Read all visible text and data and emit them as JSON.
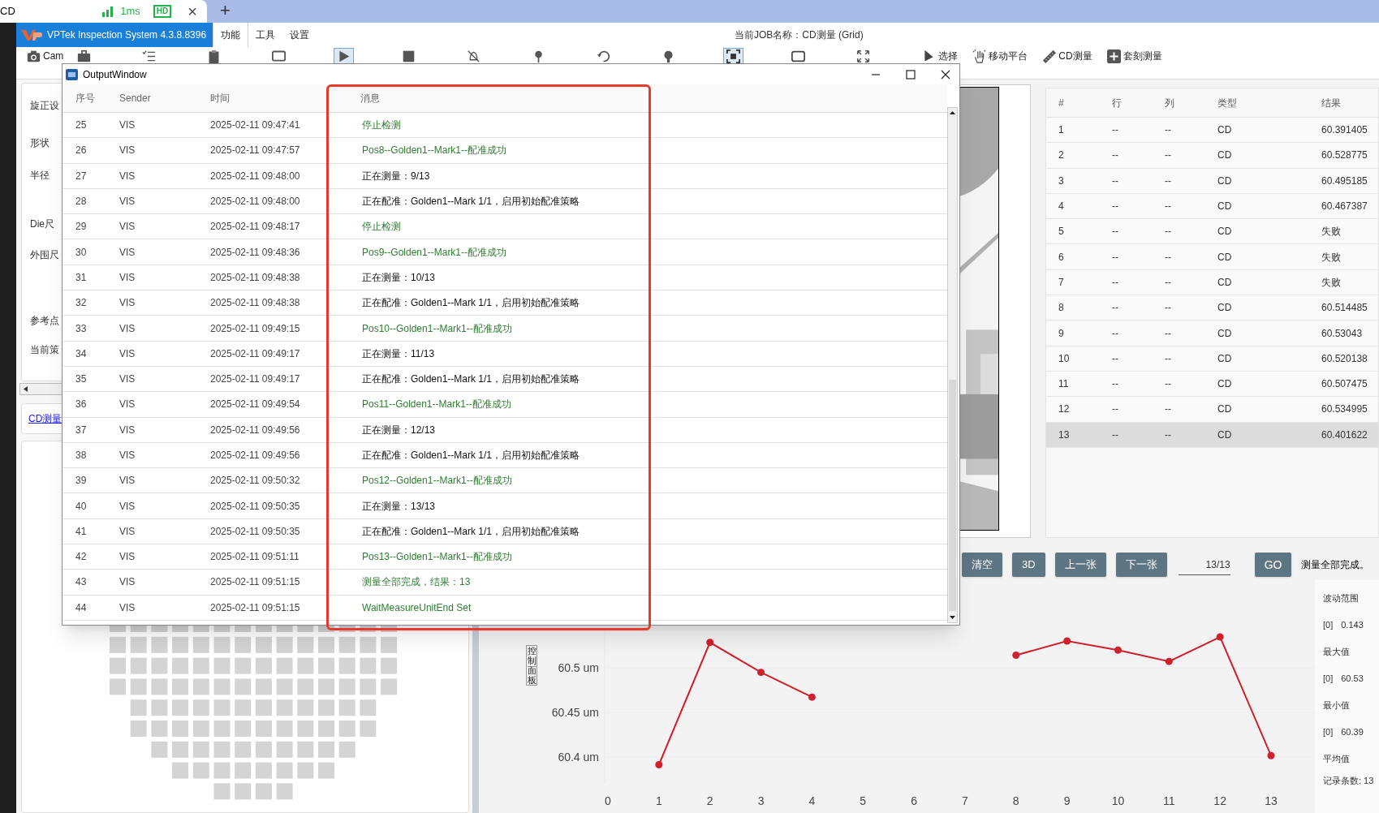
{
  "browser_tab": {
    "title": "CD",
    "ping": "1ms",
    "badge": "HD",
    "close": "×"
  },
  "new_tab": "+",
  "app": {
    "name": "VPTek Inspection System 4.3.8.8396",
    "job": "当前JOB名称：CD测量 (Grid)",
    "menus": [
      {
        "label": "功能",
        "selected": true
      },
      {
        "label": "工具",
        "selected": false
      },
      {
        "label": "设置",
        "selected": false
      }
    ]
  },
  "toolbar": [
    {
      "kind": "camera",
      "label": "Cam",
      "selected": false
    },
    {
      "kind": "briefcase",
      "selected": false
    },
    {
      "kind": "checklist",
      "selected": false
    },
    {
      "kind": "clipboard",
      "selected": false
    },
    {
      "kind": "monitor",
      "selected": false
    },
    {
      "kind": "play",
      "selected": true
    },
    {
      "kind": "stop",
      "selected": false
    },
    {
      "kind": "bell-off",
      "selected": false
    },
    {
      "kind": "pin",
      "selected": false
    },
    {
      "kind": "undo",
      "selected": false
    },
    {
      "kind": "wrench",
      "selected": false
    },
    {
      "kind": "fit",
      "selected": true
    },
    {
      "kind": "frame",
      "selected": false
    },
    {
      "kind": "expand",
      "selected": false
    },
    {
      "kind": "cursor",
      "label": "选择",
      "selected": false
    },
    {
      "kind": "hand",
      "label": "移动平台",
      "selected": false
    },
    {
      "kind": "ruler",
      "label": "CD测量",
      "selected": false
    },
    {
      "kind": "plus",
      "label": "套刻测量",
      "selected": false
    }
  ],
  "settings_labels": [
    "旋正设",
    "形状",
    "半径",
    "Die尺",
    "外围尺",
    "参考点",
    "当前策"
  ],
  "recipe_link": "CD测量",
  "results_table": {
    "columns": [
      "#",
      "行",
      "列",
      "类型",
      "结果"
    ],
    "rows": [
      {
        "cells": [
          "1",
          "--",
          "--",
          "CD",
          "60.391405"
        ],
        "selected": false
      },
      {
        "cells": [
          "2",
          "--",
          "--",
          "CD",
          "60.528775"
        ],
        "selected": false
      },
      {
        "cells": [
          "3",
          "--",
          "--",
          "CD",
          "60.495185"
        ],
        "selected": false
      },
      {
        "cells": [
          "4",
          "--",
          "--",
          "CD",
          "60.467387"
        ],
        "selected": false
      },
      {
        "cells": [
          "5",
          "--",
          "--",
          "CD",
          "失败"
        ],
        "selected": false
      },
      {
        "cells": [
          "6",
          "--",
          "--",
          "CD",
          "失败"
        ],
        "selected": false
      },
      {
        "cells": [
          "7",
          "--",
          "--",
          "CD",
          "失败"
        ],
        "selected": false
      },
      {
        "cells": [
          "8",
          "--",
          "--",
          "CD",
          "60.514485"
        ],
        "selected": false
      },
      {
        "cells": [
          "9",
          "--",
          "--",
          "CD",
          "60.53043"
        ],
        "selected": false
      },
      {
        "cells": [
          "10",
          "--",
          "--",
          "CD",
          "60.520138"
        ],
        "selected": false
      },
      {
        "cells": [
          "11",
          "--",
          "--",
          "CD",
          "60.507475"
        ],
        "selected": false
      },
      {
        "cells": [
          "12",
          "--",
          "--",
          "CD",
          "60.534995"
        ],
        "selected": false
      },
      {
        "cells": [
          "13",
          "--",
          "--",
          "CD",
          "60.401622"
        ],
        "selected": true
      }
    ]
  },
  "controls": {
    "buttons": [
      "清空",
      "3D",
      "上一张",
      "下一张"
    ],
    "page": "13/13",
    "go": "GO",
    "status": "测量全部完成。"
  },
  "control_panel_tab": "控制面板",
  "chart": {
    "chart_data": {
      "type": "line",
      "x": [
        1,
        2,
        3,
        4,
        5,
        6,
        7,
        8,
        9,
        10,
        11,
        12,
        13
      ],
      "series": [
        {
          "color": "#d0202e",
          "marker": "circle",
          "values": [
            60.391405,
            60.528775,
            60.495185,
            60.467387,
            null,
            null,
            null,
            60.514485,
            60.53043,
            60.520138,
            60.507475,
            60.534995,
            60.401622
          ]
        }
      ],
      "xticks": [
        0,
        1,
        2,
        3,
        4,
        5,
        6,
        7,
        8,
        9,
        10,
        11,
        12,
        13
      ],
      "yticks": [
        {
          "value": 60.4,
          "label": "60.4 um"
        },
        {
          "value": 60.45,
          "label": "60.45 um"
        },
        {
          "value": 60.5,
          "label": "60.5 um"
        }
      ],
      "xlim": [
        0,
        13
      ],
      "ylim": [
        60.37,
        60.545
      ]
    }
  },
  "stats": [
    {
      "label": "波动范围",
      "index": "[0]",
      "value": "0.143"
    },
    {
      "label": "最大值",
      "index": "[0]",
      "value": "60.53"
    },
    {
      "label": "最小值",
      "index": "[0]",
      "value": "60.39"
    },
    {
      "label": "平均值"
    }
  ],
  "record_count": "记录条数: 13",
  "output_window": {
    "title": "OutputWindow",
    "columns": [
      "序号",
      "Sender",
      "时间",
      "消息"
    ],
    "rows": [
      {
        "no": "25",
        "sender": "VIS",
        "time": "2025-02-11 09:47:41",
        "message": "停止检测",
        "kind": "success"
      },
      {
        "no": "26",
        "sender": "VIS",
        "time": "2025-02-11 09:47:57",
        "message": "Pos8--Golden1--Mark1--配准成功",
        "kind": "success"
      },
      {
        "no": "27",
        "sender": "VIS",
        "time": "2025-02-11 09:48:00",
        "message": "正在测量：9/13",
        "kind": "info"
      },
      {
        "no": "28",
        "sender": "VIS",
        "time": "2025-02-11 09:48:00",
        "message": "正在配准：Golden1--Mark 1/1，启用初始配准策略",
        "kind": "info"
      },
      {
        "no": "29",
        "sender": "VIS",
        "time": "2025-02-11 09:48:17",
        "message": "停止检测",
        "kind": "success"
      },
      {
        "no": "30",
        "sender": "VIS",
        "time": "2025-02-11 09:48:36",
        "message": "Pos9--Golden1--Mark1--配准成功",
        "kind": "success"
      },
      {
        "no": "31",
        "sender": "VIS",
        "time": "2025-02-11 09:48:38",
        "message": "正在测量：10/13",
        "kind": "info"
      },
      {
        "no": "32",
        "sender": "VIS",
        "time": "2025-02-11 09:48:38",
        "message": "正在配准：Golden1--Mark 1/1，启用初始配准策略",
        "kind": "info"
      },
      {
        "no": "33",
        "sender": "VIS",
        "time": "2025-02-11 09:49:15",
        "message": "Pos10--Golden1--Mark1--配准成功",
        "kind": "success"
      },
      {
        "no": "34",
        "sender": "VIS",
        "time": "2025-02-11 09:49:17",
        "message": "正在测量：11/13",
        "kind": "info"
      },
      {
        "no": "35",
        "sender": "VIS",
        "time": "2025-02-11 09:49:17",
        "message": "正在配准：Golden1--Mark 1/1，启用初始配准策略",
        "kind": "info"
      },
      {
        "no": "36",
        "sender": "VIS",
        "time": "2025-02-11 09:49:54",
        "message": "Pos11--Golden1--Mark1--配准成功",
        "kind": "success"
      },
      {
        "no": "37",
        "sender": "VIS",
        "time": "2025-02-11 09:49:56",
        "message": "正在测量：12/13",
        "kind": "info"
      },
      {
        "no": "38",
        "sender": "VIS",
        "time": "2025-02-11 09:49:56",
        "message": "正在配准：Golden1--Mark 1/1，启用初始配准策略",
        "kind": "info"
      },
      {
        "no": "39",
        "sender": "VIS",
        "time": "2025-02-11 09:50:32",
        "message": "Pos12--Golden1--Mark1--配准成功",
        "kind": "success"
      },
      {
        "no": "40",
        "sender": "VIS",
        "time": "2025-02-11 09:50:35",
        "message": "正在测量：13/13",
        "kind": "info"
      },
      {
        "no": "41",
        "sender": "VIS",
        "time": "2025-02-11 09:50:35",
        "message": "正在配准：Golden1--Mark 1/1，启用初始配准策略",
        "kind": "info"
      },
      {
        "no": "42",
        "sender": "VIS",
        "time": "2025-02-11 09:51:11",
        "message": "Pos13--Golden1--Mark1--配准成功",
        "kind": "success"
      },
      {
        "no": "43",
        "sender": "VIS",
        "time": "2025-02-11 09:51:15",
        "message": "测量全部完成，结果：13",
        "kind": "success"
      },
      {
        "no": "44",
        "sender": "VIS",
        "time": "2025-02-11 09:51:15",
        "message": "WaitMeasureUnitEnd Set",
        "kind": "success"
      }
    ]
  }
}
